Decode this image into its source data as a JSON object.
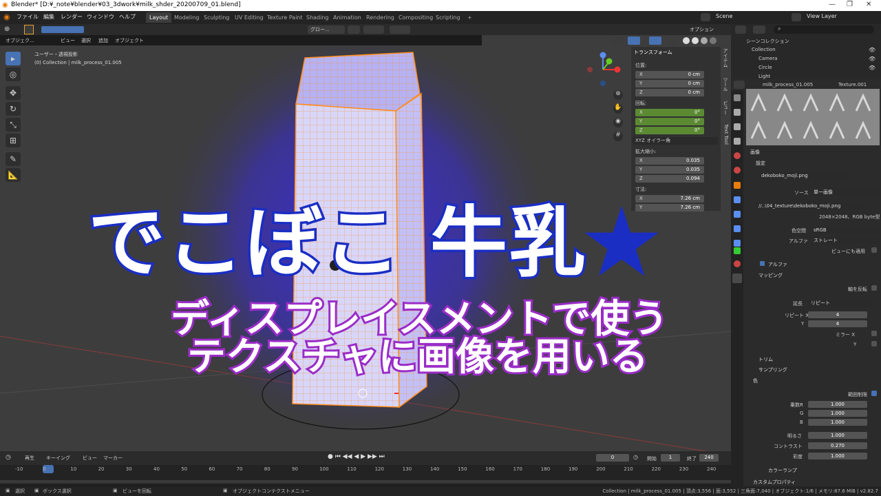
{
  "window": {
    "title": "Blender* [D:¥_note¥blender¥03_3dwork¥milk_shder_20200709_01.blend]",
    "controls": [
      "—",
      "❐",
      "✕"
    ]
  },
  "menu": [
    "ファイル",
    "編集",
    "レンダー",
    "ウィンドウ",
    "ヘルプ"
  ],
  "workspaces": [
    "Layout",
    "Modeling",
    "Sculpting",
    "UV Editing",
    "Texture Paint",
    "Shading",
    "Animation",
    "Rendering",
    "Compositing",
    "Scripting",
    "+"
  ],
  "scene": {
    "name": "Scene",
    "view_layer": "View Layer"
  },
  "viewport_header": {
    "mode": "オブジェク...",
    "menus": [
      "ビュー",
      "選択",
      "追加",
      "オブジェクト"
    ],
    "orientation": "グロー...",
    "options": "オプション"
  },
  "viewport_info": {
    "projection": "ユーザー・透視投影",
    "context": "(0) Collection | milk_process_01.005"
  },
  "npanel": {
    "section": "トランスフォーム",
    "location_label": "位置:",
    "location": [
      {
        "k": "X",
        "v": "0 cm"
      },
      {
        "k": "Y",
        "v": "0 cm"
      },
      {
        "k": "Z",
        "v": "0 cm"
      }
    ],
    "rotation_label": "回転:",
    "rotation": [
      {
        "k": "X",
        "v": "0°"
      },
      {
        "k": "Y",
        "v": "0°"
      },
      {
        "k": "Z",
        "v": "0°"
      }
    ],
    "euler": "XYZ オイラー角",
    "scale_label": "拡大縮小:",
    "scale": [
      {
        "k": "X",
        "v": "0.035"
      },
      {
        "k": "Y",
        "v": "0.035"
      },
      {
        "k": "Z",
        "v": "0.094"
      }
    ],
    "dims_label": "寸法:",
    "dims": [
      {
        "k": "X",
        "v": "7.26 cm"
      },
      {
        "k": "Y",
        "v": "7.26 cm"
      }
    ],
    "tabs": [
      "アイテム",
      "ツール",
      "ビュー",
      "Text Tool"
    ]
  },
  "overlay": {
    "title": "でこぼこ 牛乳",
    "star": "★",
    "sub1": "ディスプレイスメントで使う",
    "sub2": "テクスチャに画像を用いる"
  },
  "outliner": {
    "root": "シーンコレクション",
    "collection": "Collection",
    "items": [
      "Camera",
      "Circle",
      "Light"
    ]
  },
  "properties": {
    "object": "milk_process_01.005",
    "texture": "Texture.001",
    "image_section": "画像",
    "settings": "設定",
    "image_name": "dekoboko_moji.png",
    "source_label": "ソース",
    "source": "単一画像",
    "path": "//..\\04_texture\\dekoboko_moji.png",
    "info": "2048×2048、RGB byte型",
    "colorspace_label": "色空間",
    "colorspace": "sRGB",
    "alpha_label": "アルファ",
    "alpha": "ストレート",
    "view_as": "ビューにも適用",
    "alpha_section": "アルファ",
    "mapping": "マッピング",
    "flip_axis": "軸を反転",
    "extension_label": "延長",
    "extension": "リピート",
    "repeat_x_label": "リピート X",
    "repeat_x": "4",
    "repeat_y_label": "Y",
    "repeat_y": "4",
    "mirror_x": "ミラー X",
    "mirror_y": "Y",
    "crop": "トリム",
    "sampling": "サンプリング",
    "colors_section": "色",
    "clamp": "範囲制限",
    "mult_r_label": "乗数R",
    "mult_r": "1.000",
    "mult_g_label": "G",
    "mult_g": "1.000",
    "mult_b_label": "B",
    "mult_b": "1.000",
    "bright_label": "明るさ",
    "bright": "1.000",
    "contrast_label": "コントラスト",
    "contrast": "0.270",
    "sat_label": "彩度",
    "sat": "1.000",
    "color_ramp": "カラーランプ",
    "custom_props": "カスタムプロパティ"
  },
  "timeline": {
    "menus": [
      "再生",
      "キーイング",
      "ビュー",
      "マーカー"
    ],
    "current": "0",
    "start_label": "開始",
    "start": "1",
    "end_label": "終了",
    "end": "240",
    "ticks": [
      "-10",
      "0",
      "10",
      "20",
      "30",
      "40",
      "50",
      "60",
      "70",
      "80",
      "90",
      "100",
      "110",
      "120",
      "130",
      "140",
      "150",
      "160",
      "170",
      "180",
      "190",
      "200",
      "210",
      "220",
      "230",
      "240"
    ]
  },
  "status": {
    "select": "選択",
    "box_select": "ボックス選択",
    "rotate_view": "ビューを回転",
    "context_menu": "オブジェクトコンテクストメニュー",
    "stats": "Collection | milk_process_01.005 | 頂点:3,556 | 面:3,552 | 三角面:7,040 | オブジェクト:1/6 | メモリ:87.6 MiB | v2.82.7"
  },
  "colors": {
    "accent": "#4772b3",
    "title_fill": "#1a2ec4",
    "subtitle_stroke": "#9a2cc7",
    "green_field": "#5b8a33"
  }
}
